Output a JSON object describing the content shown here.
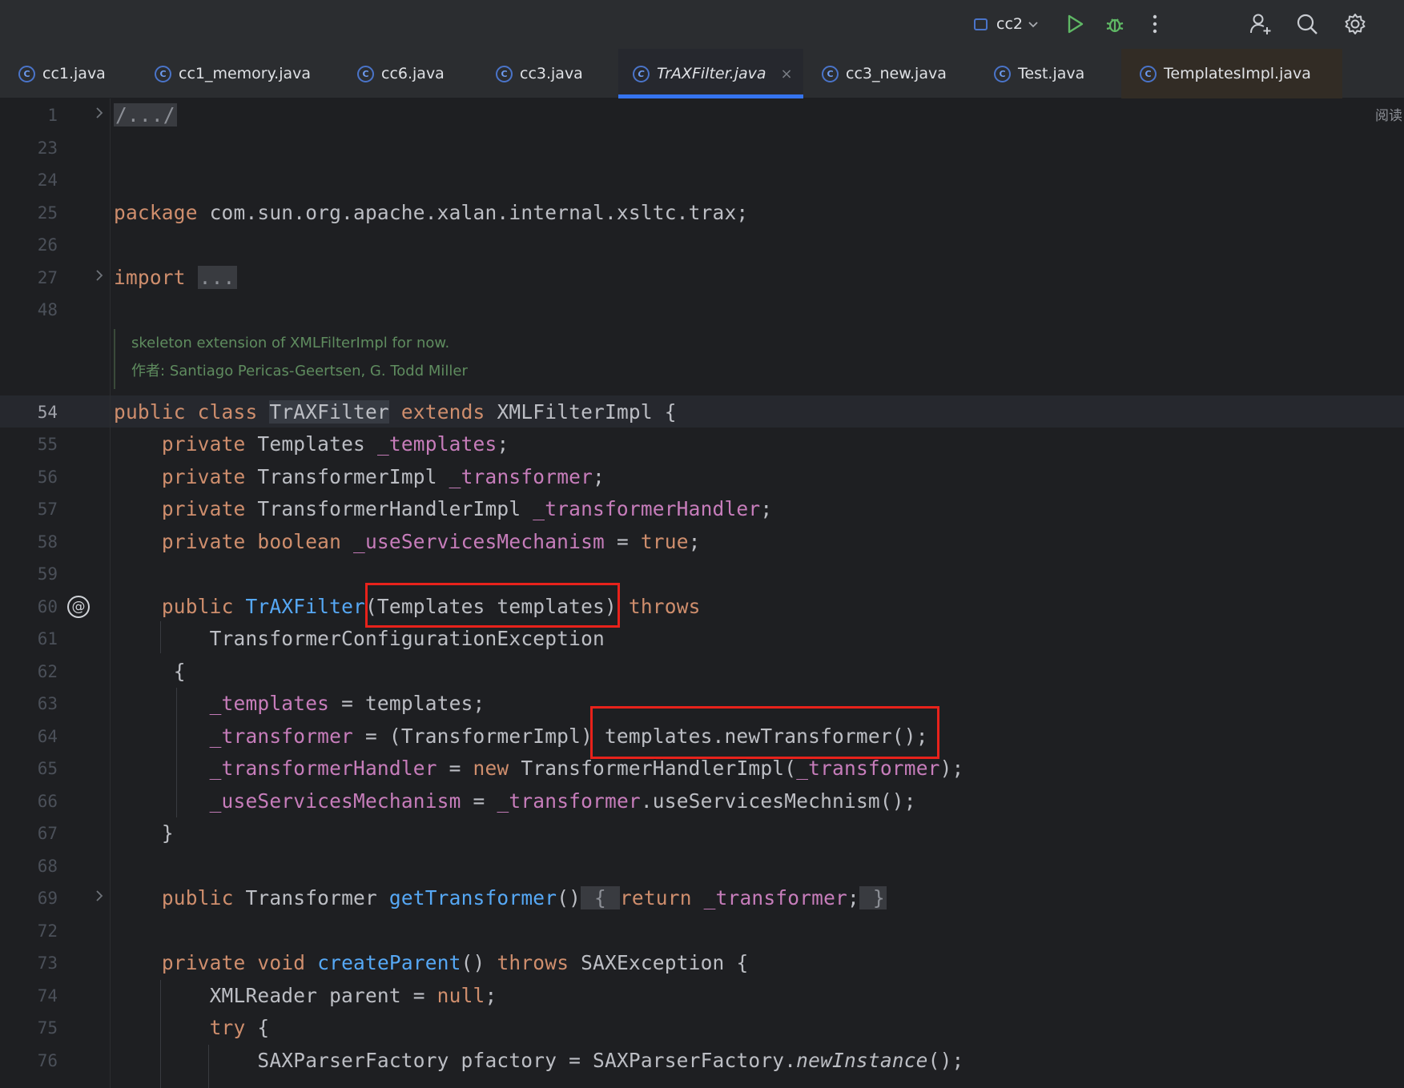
{
  "toolbar": {
    "project_name": "cc2",
    "icons": [
      "project-box-icon",
      "chevron-down-icon",
      "run-icon",
      "debug-icon",
      "more-icon",
      "add-user-icon",
      "search-icon",
      "gear-icon"
    ]
  },
  "tabs": [
    {
      "label": "cc1.java",
      "icon": "class-icon"
    },
    {
      "label": "cc1_memory.java",
      "icon": "class-icon"
    },
    {
      "label": "cc6.java",
      "icon": "class-icon"
    },
    {
      "label": "cc3.java",
      "icon": "class-icon"
    },
    {
      "label": "TrAXFilter.java",
      "icon": "class-icon",
      "active": true,
      "close": "×"
    },
    {
      "label": "cc3_new.java",
      "icon": "class-icon"
    },
    {
      "label": "Test.java",
      "icon": "class-icon"
    },
    {
      "label": "TemplatesImpl.java",
      "icon": "class-icon"
    }
  ],
  "gutter": {
    "line_numbers": [
      "1",
      "23",
      "24",
      "25",
      "26",
      "27",
      "48",
      "54",
      "55",
      "56",
      "57",
      "58",
      "59",
      "60",
      "61",
      "62",
      "63",
      "64",
      "65",
      "66",
      "67",
      "68",
      "69",
      "72",
      "73",
      "74",
      "75",
      "76"
    ],
    "current_line": "54",
    "override_marker": "@"
  },
  "reader_mode_label": "阅读",
  "javadoc": {
    "line1": "skeleton extension of XMLFilterImpl for now.",
    "author_label": "作者:",
    "author": "Santiago Pericas-Geertsen, G. Todd Miller"
  },
  "code": {
    "l1": "/.../",
    "l25_kw": "package",
    "l25_rest": " com.sun.org.apache.xalan.internal.xsltc.trax;",
    "l27_kw": "import",
    "l27_fold": "...",
    "l54_kw1": "public",
    "l54_kw2": "class",
    "l54_cls": "TrAXFilter",
    "l54_kw3": "extends",
    "l54_rest": " XMLFilterImpl {",
    "l55_type": "Templates",
    "l55_field": "_templates",
    "l56_type": "TransformerImpl",
    "l56_field": "_transformer",
    "l57_type": "TransformerHandlerImpl",
    "l57_field": "_transformerHandler",
    "l58_kw": "boolean",
    "l58_field": "_useServicesMechanism",
    "l58_val": "true",
    "private": "private",
    "public": "public",
    "l60_ctor": "TrAXFilter",
    "l60_params": "(Templates templates)",
    "l60_throws": "throws",
    "l61_exc": "TransformerConfigurationException",
    "l62_brace": "{",
    "l63_field": "_templates",
    "l63_rest": " = templates;",
    "l64_field": "_transformer",
    "l64_cast": " = (TransformerImpl)",
    "l64_call": " templates.newTransformer();",
    "l65_field": "_transformerHandler",
    "l65_eq": " = ",
    "l65_new": "new",
    "l65_mid": " TransformerHandlerImpl(",
    "l65_arg": "_transformer",
    "l65_end": ");",
    "l66_field": "_useServicesMechanism",
    "l66_eq": " = ",
    "l66_field2": "_transformer",
    "l66_rest": ".useServicesMechnism();",
    "l67_brace": "}",
    "l69_type": " Transformer ",
    "l69_fn": "getTransformer",
    "l69_paren": "()",
    "l69_open": " { ",
    "l69_return": "return",
    "l69_field": "_transformer",
    "l69_close": " }",
    "l73_void": "void",
    "l73_fn": "createParent",
    "l73_paren": "() ",
    "l73_throws": "throws",
    "l73_rest": " SAXException {",
    "l74_type": "XMLReader parent = ",
    "l74_null": "null",
    "l75_try": "try",
    "l75_rest": " {",
    "l76_decl": "SAXParserFactory pfactory = SAXParserFactory.",
    "l76_fn": "newInstance",
    "l76_end": "();"
  }
}
